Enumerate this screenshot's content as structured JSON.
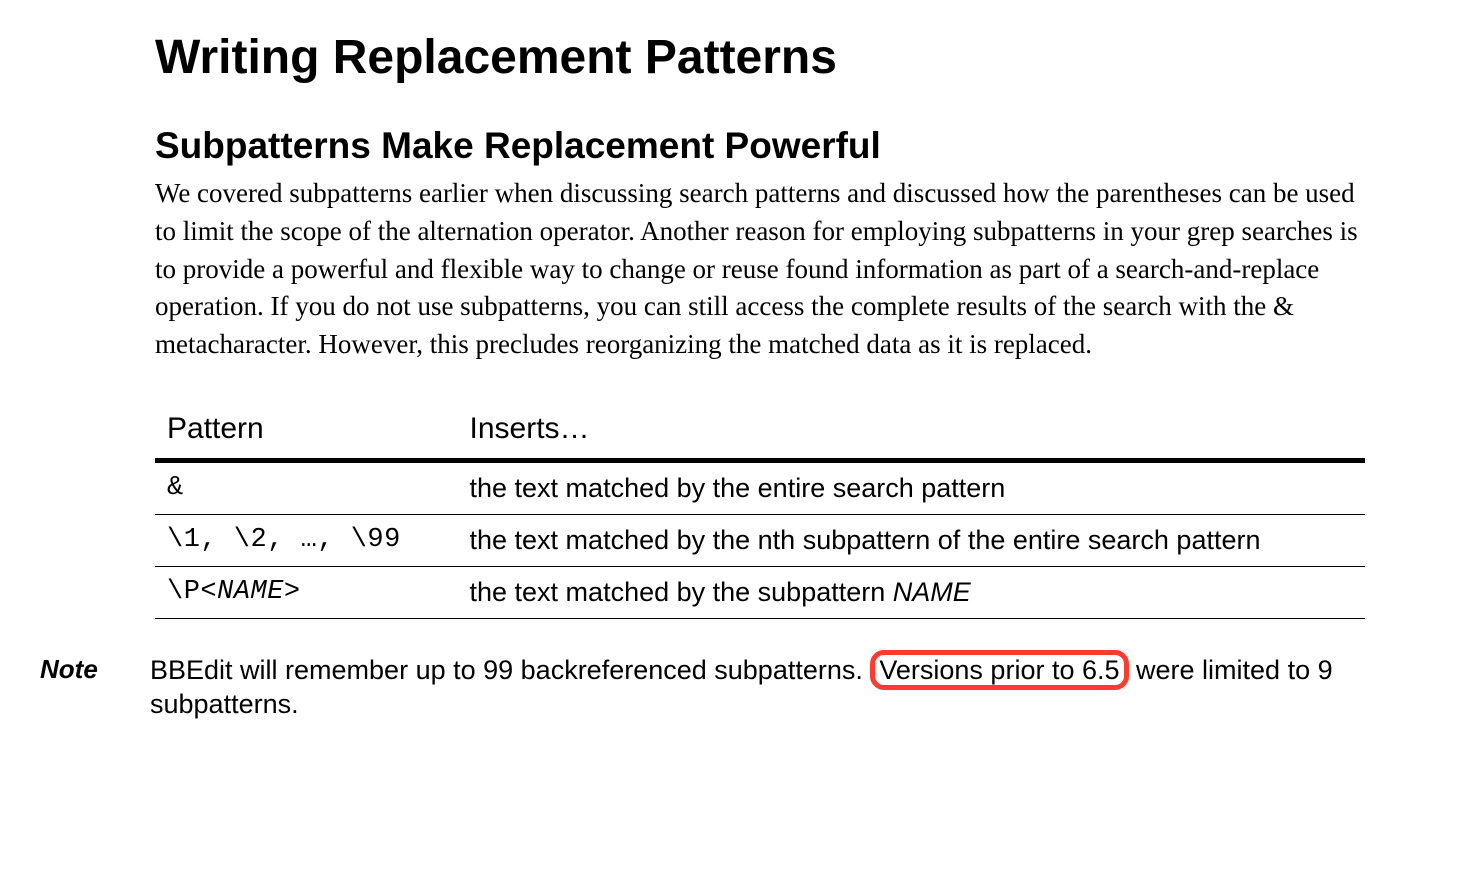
{
  "title": "Writing Replacement Patterns",
  "section_heading": "Subpatterns Make Replacement Powerful",
  "intro_paragraph": "We covered subpatterns earlier when discussing search patterns and discussed how the parentheses can be used to limit the scope of the alternation operator. Another reason for employing subpatterns in your grep searches is to provide a powerful and flexible way to change or reuse found information as part of a search-and-replace operation. If you do not use subpatterns, you can still access the complete results of the search with the & metacharacter. However, this precludes reorganizing the matched data as it is replaced.",
  "table": {
    "headers": {
      "col1": "Pattern",
      "col2": "Inserts…"
    },
    "rows": [
      {
        "pattern": "&",
        "inserts": "the text matched by the entire search pattern"
      },
      {
        "pattern": "\\1, \\2, …, \\99",
        "inserts": "the text matched by the nth subpattern of the entire search pattern"
      },
      {
        "pattern_prefix": "\\P<",
        "pattern_italic": "NAME",
        "pattern_suffix": ">",
        "inserts_prefix": "the text matched by the subpattern ",
        "inserts_italic": "NAME"
      }
    ]
  },
  "note": {
    "label": "Note",
    "text_before": "BBEdit will remember up to 99 backreferenced subpatterns. ",
    "highlighted": "Versions prior to 6.5",
    "text_after": " were limited to 9 subpatterns."
  }
}
